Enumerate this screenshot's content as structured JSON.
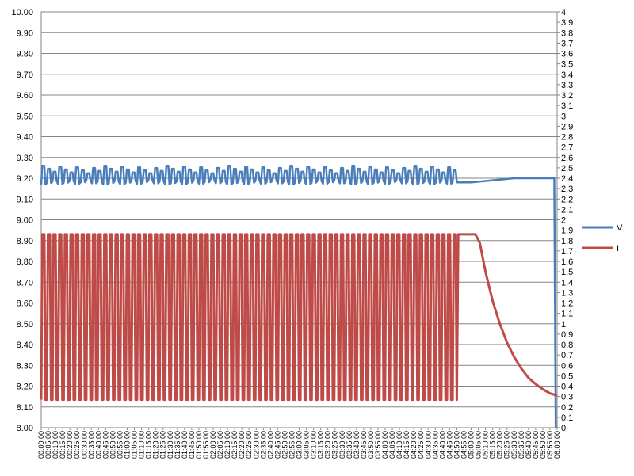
{
  "chart_data": {
    "type": "line",
    "title": "",
    "xlabel": "",
    "ylabel": "",
    "y_left": {
      "min": 8.0,
      "max": 10.0,
      "step": 0.1,
      "ticks": [
        "8.00",
        "8.10",
        "8.20",
        "8.30",
        "8.40",
        "8.50",
        "8.60",
        "8.70",
        "8.80",
        "8.90",
        "9.00",
        "9.10",
        "9.20",
        "9.30",
        "9.40",
        "9.50",
        "9.60",
        "9.70",
        "9.80",
        "9.90",
        "10.00"
      ]
    },
    "y_right": {
      "min": 0,
      "max": 4,
      "step": 0.1,
      "ticks": [
        "0",
        "0.1",
        "0.2",
        "0.3",
        "0.4",
        "0.5",
        "0.6",
        "0.7",
        "0.8",
        "0.9",
        "1",
        "1.1",
        "1.2",
        "1.3",
        "1.4",
        "1.5",
        "1.6",
        "1.7",
        "1.8",
        "1.9",
        "2",
        "2.1",
        "2.2",
        "2.3",
        "2.4",
        "2.5",
        "2.6",
        "2.7",
        "2.8",
        "2.9",
        "3",
        "3.1",
        "3.2",
        "3.3",
        "3.4",
        "3.5",
        "3.6",
        "3.7",
        "3.8",
        "3.9",
        "4"
      ]
    },
    "x_range_min": [
      0,
      360
    ],
    "x_ticks": [
      "00:00:00",
      "00:05:00",
      "00:10:00",
      "00:15:00",
      "00:20:00",
      "00:25:00",
      "00:30:00",
      "00:35:00",
      "00:40:00",
      "00:45:00",
      "00:50:00",
      "00:55:00",
      "01:00:00",
      "01:05:00",
      "01:10:00",
      "01:15:00",
      "01:20:00",
      "01:25:00",
      "01:30:00",
      "01:35:00",
      "01:40:00",
      "01:45:00",
      "01:50:00",
      "01:55:00",
      "02:00:00",
      "02:05:00",
      "02:10:00",
      "02:15:00",
      "02:20:00",
      "02:25:00",
      "02:30:00",
      "02:35:00",
      "02:40:00",
      "02:45:00",
      "02:50:00",
      "02:55:00",
      "03:00:00",
      "03:05:00",
      "03:10:00",
      "03:15:00",
      "03:20:00",
      "03:25:00",
      "03:30:00",
      "03:35:00",
      "03:40:00",
      "03:45:00",
      "03:50:00",
      "03:55:00",
      "04:00:00",
      "04:05:00",
      "04:10:00",
      "04:15:00",
      "04:20:00",
      "04:25:00",
      "04:30:00",
      "04:35:00",
      "04:40:00",
      "04:45:00",
      "04:50:00",
      "04:55:00",
      "05:00:00",
      "05:05:00",
      "05:10:00",
      "05:15:00",
      "05:20:00",
      "05:25:00",
      "05:30:00",
      "05:35:00",
      "05:40:00",
      "05:45:00",
      "05:50:00",
      "05:55:00",
      "06:00:00"
    ],
    "grid": true,
    "legend_position": "right",
    "series": [
      {
        "name": "V",
        "axis": "left",
        "color": "#4A7EBB",
        "pulsed_until_min": 291,
        "pulse_count": 74,
        "pulse_low": 9.17,
        "pulse_high": 9.26,
        "points": [
          [
            291,
            9.18
          ],
          [
            300,
            9.18
          ],
          [
            315,
            9.19
          ],
          [
            330,
            9.2
          ],
          [
            345,
            9.2
          ],
          [
            358,
            9.2
          ],
          [
            359,
            8.0
          ]
        ]
      },
      {
        "name": "I",
        "axis": "right",
        "color": "#BE4B48",
        "pulsed_until_min": 291,
        "pulse_count": 74,
        "pulse_low": 0.27,
        "pulse_high": 1.86,
        "points": [
          [
            291,
            1.86
          ],
          [
            303,
            1.86
          ],
          [
            306,
            1.78
          ],
          [
            310,
            1.5
          ],
          [
            315,
            1.22
          ],
          [
            320,
            1.0
          ],
          [
            325,
            0.82
          ],
          [
            330,
            0.68
          ],
          [
            335,
            0.57
          ],
          [
            340,
            0.48
          ],
          [
            345,
            0.42
          ],
          [
            350,
            0.37
          ],
          [
            355,
            0.33
          ],
          [
            360,
            0.31
          ]
        ]
      }
    ]
  }
}
